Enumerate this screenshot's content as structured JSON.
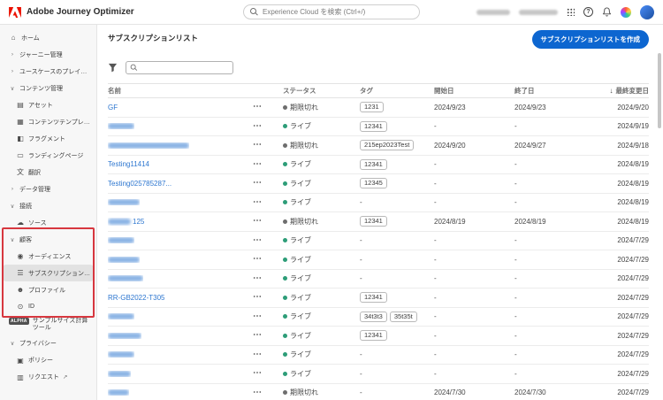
{
  "colors": {
    "accent": "#0d66d0",
    "link": "#2e77d0",
    "status_live": "#2d9d78",
    "status_expired": "#6e6e6e",
    "annotation": "#d7373f",
    "logo_red": "#eb1000"
  },
  "icons": {
    "chevron-right": "›",
    "chevron-down": "∨",
    "home": "⌂",
    "asset": "▤",
    "template": "▦",
    "fragment": "◧",
    "landing": "▭",
    "translate": "文",
    "source": "☁",
    "audience": "◉",
    "subscription": "☰",
    "profile": "☻",
    "id": "⊙",
    "policy": "▣",
    "request": "▥",
    "external-link": "↗",
    "help": "?",
    "sort-desc": "↓",
    "more": "⋯"
  },
  "topbar": {
    "app_title": "Adobe Journey Optimizer",
    "search_placeholder": "Experience Cloud を検索 (Ctrl+/)"
  },
  "sidebar": {
    "items": [
      {
        "id": "home",
        "label": "ホーム",
        "icon": "home"
      },
      {
        "id": "journeys",
        "label": "ジャーニー管理",
        "chevron": "right"
      },
      {
        "id": "playbooks",
        "label": "ユースケースのプレイブック",
        "chevron": "right"
      },
      {
        "id": "content",
        "label": "コンテンツ管理",
        "chevron": "down"
      },
      {
        "id": "assets",
        "label": "アセット",
        "icon": "asset",
        "level": 1
      },
      {
        "id": "content-templates",
        "label": "コンテンツテンプレート",
        "icon": "template",
        "level": 1
      },
      {
        "id": "fragments",
        "label": "フラグメント",
        "icon": "fragment",
        "level": 1
      },
      {
        "id": "landing-pages",
        "label": "ランディングページ",
        "icon": "landing",
        "level": 1
      },
      {
        "id": "translation",
        "label": "翻訳",
        "icon": "translate",
        "level": 1
      },
      {
        "id": "data",
        "label": "データ管理",
        "chevron": "right"
      },
      {
        "id": "connections",
        "label": "接続",
        "chevron": "down"
      },
      {
        "id": "sources",
        "label": "ソース",
        "icon": "source",
        "level": 1
      },
      {
        "id": "customer",
        "label": "顧客",
        "chevron": "down"
      },
      {
        "id": "audiences",
        "label": "オーディエンス",
        "icon": "audience",
        "level": 1
      },
      {
        "id": "subscription-lists",
        "label": "サブスクリプションリスト",
        "icon": "subscription",
        "level": 1,
        "selected": true
      },
      {
        "id": "profiles",
        "label": "プロファイル",
        "icon": "profile",
        "level": 1
      },
      {
        "id": "id",
        "label": "ID",
        "icon": "id",
        "level": 1
      },
      {
        "id": "sample-size-calculator",
        "label": "サンプルサイズ計算ツール",
        "badge": "ALPHA",
        "wrap": true
      },
      {
        "id": "privacy",
        "label": "プライバシー",
        "chevron": "down"
      },
      {
        "id": "policies",
        "label": "ポリシー",
        "icon": "policy",
        "level": 1
      },
      {
        "id": "requests",
        "label": "リクエスト",
        "icon": "request",
        "level": 1,
        "external": true
      }
    ]
  },
  "main": {
    "title": "サブスクリプションリスト",
    "create_button": "サブスクリプションリストを作成",
    "status_labels": {
      "live": "ライブ",
      "expired": "期限切れ"
    },
    "table": {
      "columns": [
        "名前",
        "ステータス",
        "タグ",
        "開始日",
        "終了日",
        "最終変更日"
      ],
      "sorted_column": "最終変更日",
      "rows": [
        {
          "name": "GF",
          "status": "expired",
          "status_label": "期限切れ",
          "tags": [
            "1231"
          ],
          "start": "2024/9/23",
          "end": "2024/9/23",
          "modified": "2024/9/20"
        },
        {
          "mask": 30,
          "status": "live",
          "status_label": "ライブ",
          "tags": [
            "12341"
          ],
          "start": "-",
          "end": "-",
          "modified": "2024/9/19"
        },
        {
          "mask": 92,
          "status": "expired",
          "status_label": "期限切れ",
          "tags": [
            "215ep2023Test"
          ],
          "start": "2024/9/20",
          "end": "2024/9/27",
          "modified": "2024/9/18"
        },
        {
          "name": "Testing11414",
          "status": "live",
          "status_label": "ライブ",
          "tags": [
            "12341"
          ],
          "start": "-",
          "end": "-",
          "modified": "2024/8/19"
        },
        {
          "name": "Testing025785287...",
          "status": "live",
          "status_label": "ライブ",
          "tags": [
            "12345"
          ],
          "start": "-",
          "end": "-",
          "modified": "2024/8/19"
        },
        {
          "mask": 36,
          "status": "live",
          "status_label": "ライブ",
          "tags": [],
          "start": "-",
          "end": "-",
          "modified": "2024/8/19"
        },
        {
          "mask": 26,
          "suffix": "125",
          "status": "expired",
          "status_label": "期限切れ",
          "tags": [
            "12341"
          ],
          "start": "2024/8/19",
          "end": "2024/8/19",
          "modified": "2024/8/19"
        },
        {
          "mask": 30,
          "status": "live",
          "status_label": "ライブ",
          "tags": [],
          "start": "-",
          "end": "-",
          "modified": "2024/7/29"
        },
        {
          "mask": 36,
          "status": "live",
          "status_label": "ライブ",
          "tags": [],
          "start": "-",
          "end": "-",
          "modified": "2024/7/29"
        },
        {
          "mask": 40,
          "status": "live",
          "status_label": "ライブ",
          "tags": [],
          "start": "-",
          "end": "-",
          "modified": "2024/7/29"
        },
        {
          "name": "RR-GB2022-T305",
          "status": "live",
          "status_label": "ライブ",
          "tags": [
            "12341"
          ],
          "start": "-",
          "end": "-",
          "modified": "2024/7/29"
        },
        {
          "mask": 30,
          "status": "live",
          "status_label": "ライブ",
          "tags": [
            "34t3t3",
            "35t35t"
          ],
          "start": "-",
          "end": "-",
          "modified": "2024/7/29"
        },
        {
          "mask": 38,
          "status": "live",
          "status_label": "ライブ",
          "tags": [
            "12341"
          ],
          "start": "-",
          "end": "-",
          "modified": "2024/7/29"
        },
        {
          "mask": 30,
          "status": "live",
          "status_label": "ライブ",
          "tags": [],
          "start": "-",
          "end": "-",
          "modified": "2024/7/29"
        },
        {
          "mask": 26,
          "status": "live",
          "status_label": "ライブ",
          "tags": [],
          "start": "-",
          "end": "-",
          "modified": "2024/7/29"
        },
        {
          "mask": 24,
          "status": "expired",
          "status_label": "期限切れ",
          "tags": [],
          "start": "2024/7/30",
          "end": "2024/7/30",
          "modified": "2024/7/29"
        }
      ]
    }
  }
}
